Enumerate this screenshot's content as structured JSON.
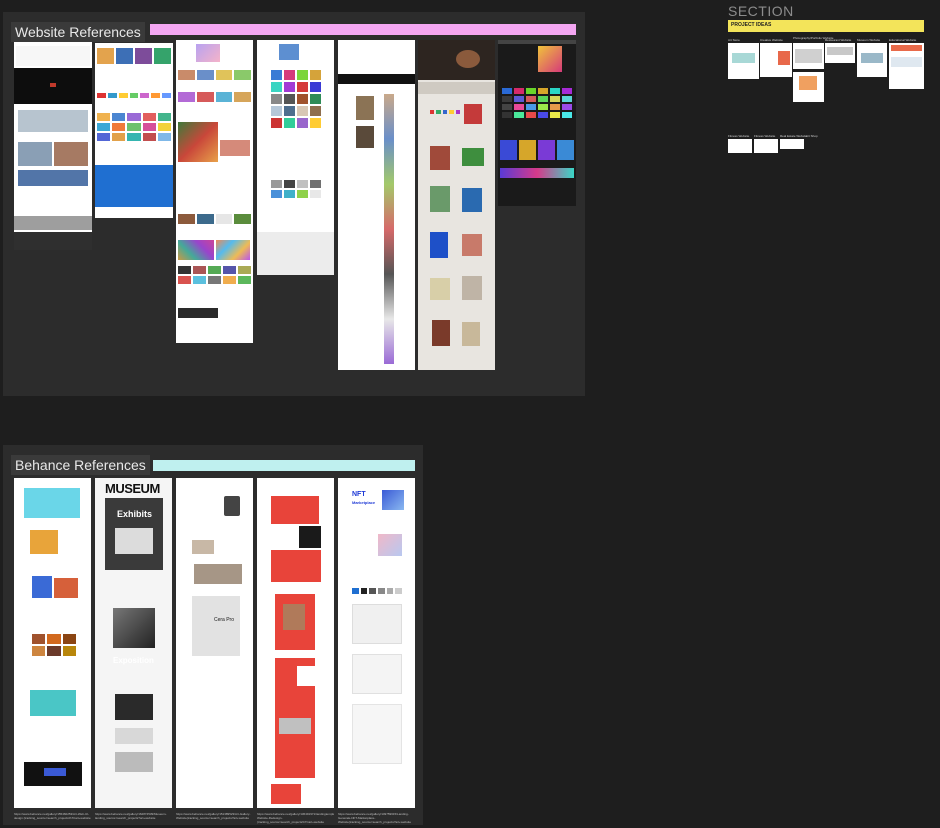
{
  "website_section": {
    "label": "Website References",
    "bar_color": "#f3a6f2"
  },
  "behance_section": {
    "label": "Behance References",
    "bar_color": "#bff0ef",
    "mock_texts": {
      "museum": "MUSEUM",
      "exhibits": "Exhibits",
      "exposition": "Exposition",
      "cera_pro": "Cera Pro",
      "nft": "NFT",
      "marketplace": "Marketplace"
    },
    "captions": [
      "https://www.behance.net/gallery/155460253/Art-Web-UI-design (tracking_source=search_projects%7Cart+website",
      "https://www.behance.net/gallery/162874539/Museum-landing_source=search_projects?art+website",
      "https://www.behance.net/gallery/151389523/Art-Gallery-Website(tracking_source=search_projects?art+website",
      "https://www.behance.net/gallery/136491971/landingtemplate-Website-Redesign-(tracking_source=search_projects%7Cart+website",
      "https://www.behance.net/gallery/149759615/Landing-Generale-NFT-Marketplace-Website(tracking_source=search_projects?art+website"
    ]
  },
  "project_ideas": {
    "section_title": "SECTION",
    "band_title": "PROJECT IDEAS",
    "row1": [
      "Art Store",
      "Creative Website",
      "Photography/Portfolio Website",
      "Restaurant Website",
      "Museum Website",
      "Educational Website"
    ],
    "row2": [
      "Fitness Website",
      "Fitness Website",
      "Real Estate Website",
      "Art Shop"
    ]
  },
  "colors": {
    "canvas": "#1e1e1e",
    "frame": "#2c2c2c",
    "sticky": "#f3e45a",
    "accent_red": "#e8443a",
    "accent_blue": "#1f6fd1"
  }
}
